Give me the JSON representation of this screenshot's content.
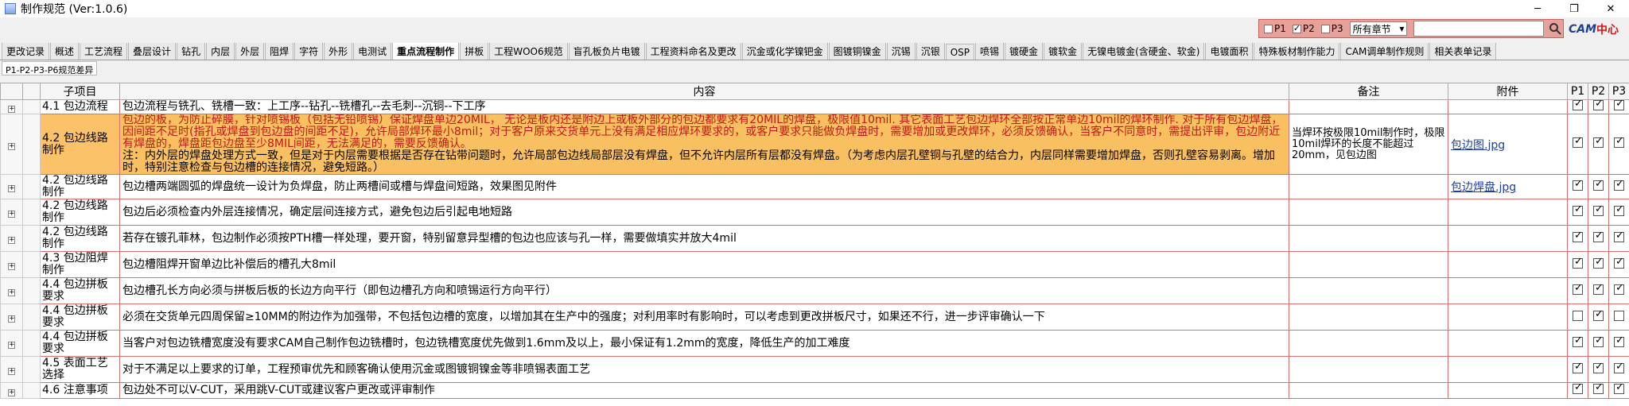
{
  "window": {
    "title": "制作规范 (Ver:1.0.6)",
    "min": "─",
    "restore": "❐",
    "close": "✕"
  },
  "filter": {
    "p1": "P1",
    "p2": "P2",
    "p3": "P3",
    "select_value": "所有章节",
    "search_placeholder": ""
  },
  "logo": {
    "text1": "CAM",
    "text2": "中心"
  },
  "tabs": [
    "更改记录",
    "概述",
    "工艺流程",
    "叠层设计",
    "钻孔",
    "内层",
    "外层",
    "阻焊",
    "字符",
    "外形",
    "电测试",
    "重点流程制作",
    "拼板",
    "工程WOO6规范",
    "盲孔板负片电镀",
    "工程资料命名及更改",
    "沉金或化学镍钯金",
    "图镀铜镍金",
    "沉锡",
    "沉银",
    "OSP",
    "喷锡",
    "镀硬金",
    "镀软金",
    "无镍电镀金(含硬金、软金)",
    "电镀面积",
    "特殊板材制作能力",
    "CAM调单制作规则",
    "相关表单记录"
  ],
  "active_tab": "重点流程制作",
  "subtab": "P1-P2-P3-P6规范差异",
  "headers": {
    "sub": "子项目",
    "content": "内容",
    "note": "备注",
    "att": "附件",
    "p1": "P1",
    "p2": "P2",
    "p3": "P3"
  },
  "rows": [
    {
      "sub": "4.1 包边流程",
      "content": "包边流程与铣孔、铣槽一致：上工序--钻孔--铣槽孔--去毛刺--沉铜--下工序",
      "note": "",
      "att": "",
      "p": [
        true,
        true,
        true
      ]
    },
    {
      "sub": "4.2 包边线路制作",
      "content_red": "包边的板，为防止碎膜，针对喷锡板（包括无铅喷锡）保证焊盘单边20MIL， 无论是板内还是附边上或板外部分的包边都要求有20MIL的焊盘，极限值10mil. 其它表面工艺包边焊环全部按正常单边10mil的焊环制作. 对于所有包边焊盘，因间距不足时(指孔或焊盘到包边盘的间距不足)，允许局部焊环最小8mil；对于客户原来交货单元上没有满足相应焊环要求的，或客户要求只能做负焊盘时，需要增加或更改焊环，必须反馈确认，当客户不同意时，需提出评审，包边附近有焊盘的，焊盘距包边盘至少8MIL间距，无法满足的，需要反馈确认。",
      "content_black": "注：内外层的焊盘处理方式一致，但是对于内层需要根据是否存在钻带问题时，允许局部包边线局部层没有焊盘，但不允许内层所有层都没有焊盘。（为考虑内层孔壁铜与孔壁的结合力，内层同样需要增加焊盘，否则孔壁容易剥离。增加时，特别注意检查与包边槽的连接情况，避免短路。）",
      "note": "当焊环按极限10mil制作时，极限10mil焊环的长度不能超过20mm，见包边图",
      "att": "包边图.jpg",
      "p": [
        true,
        true,
        true
      ]
    },
    {
      "sub": "4.2 包边线路制作",
      "content": "包边槽两端圆弧的焊盘统一设计为负焊盘，防止两槽间或槽与焊盘间短路，效果图见附件",
      "note": "",
      "att": "包边焊盘.jpg",
      "p": [
        true,
        true,
        true
      ]
    },
    {
      "sub": "4.2 包边线路制作",
      "content": "包边后必须检查内外层连接情况，确定层间连接方式，避免包边后引起电地短路",
      "note": "",
      "att": "",
      "p": [
        true,
        true,
        true
      ]
    },
    {
      "sub": "4.2 包边线路制作",
      "content": "若存在镀孔菲林，包边制作必须按PTH槽一样处理，要开窗，特别留意异型槽的包边也应该与孔一样，需要做填实并放大4mil",
      "note": "",
      "att": "",
      "p": [
        true,
        true,
        true
      ]
    },
    {
      "sub": "4.3 包边阻焊制作",
      "content": "包边槽阻焊开窗单边比补偿后的槽孔大8mil",
      "note": "",
      "att": "",
      "p": [
        true,
        true,
        true
      ]
    },
    {
      "sub": "4.4 包边拼板要求",
      "content": "包边槽孔长方向必须与拼板后板的长边方向平行（即包边槽孔方向和喷锡运行方向平行）",
      "note": "",
      "att": "",
      "p": [
        true,
        true,
        true
      ]
    },
    {
      "sub": "4.4 包边拼板要求",
      "content": "必须在交货单元四周保留≥10MM的附边作为加强带，不包括包边槽的宽度，以增加其在生产中的强度；对利用率时有影响时，可以考虑到更改拼板尺寸，如果还不行，进一步评审确认一下",
      "note": "",
      "att": "",
      "p": [
        false,
        true,
        false
      ]
    },
    {
      "sub": "4.4 包边拼板要求",
      "content": "当客户对包边铣槽宽度没有要求CAM自己制作包边铣槽时，包边铣槽宽度优先做到1.6mm及以上，最小保证有1.2mm的宽度，降低生产的加工难度",
      "note": "",
      "att": "",
      "p": [
        true,
        true,
        true
      ]
    },
    {
      "sub": "4.5 表面工艺选择",
      "content": "对于不满足以上要求的订单，工程预审优先和顾客确认使用沉金或图镀铜镍金等非喷锡表面工艺",
      "note": "",
      "att": "",
      "p": [
        true,
        true,
        true
      ]
    },
    {
      "sub": "4.6 注意事项",
      "content": "包边处不可以V-CUT，采用跳V-CUT或建议客户更改或评审制作",
      "note": "",
      "att": "",
      "p": [
        true,
        true,
        true
      ]
    }
  ]
}
